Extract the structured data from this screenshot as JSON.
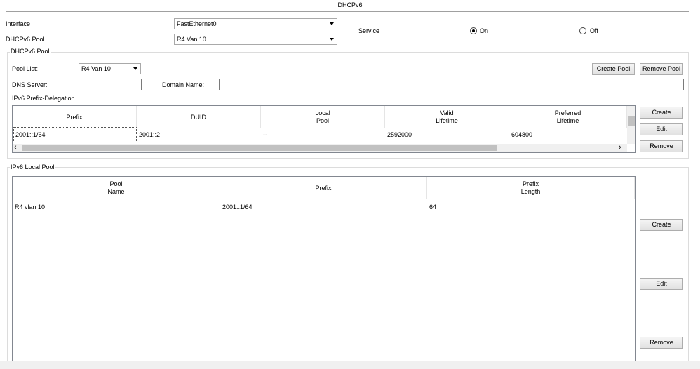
{
  "window": {
    "title": "DHCPv6"
  },
  "top": {
    "interface_label": "Interface",
    "interface_value": "FastEthernet0",
    "pool_label": "DHCPv6 Pool",
    "pool_value": "R4 Van 10",
    "service_label": "Service",
    "service_on": "On",
    "service_off": "Off",
    "service_state": "On"
  },
  "pool_group": {
    "label": "DHCPv6 Pool",
    "pool_list_label": "Pool List:",
    "pool_list_value": "R4 Van 10",
    "create_pool": "Create Pool",
    "remove_pool": "Remove Pool",
    "dns_label": "DNS Server:",
    "dns_value": "",
    "domain_label": "Domain Name:",
    "domain_value": "",
    "prefix_delegation_label": "IPv6 Prefix-Delegation",
    "columns": [
      "Prefix",
      "DUID",
      "Local\nPool",
      "Valid\nLifetime",
      "Preferred\nLifetime"
    ],
    "rows": [
      [
        "2001::1/64",
        "2001::2",
        "--",
        "2592000",
        "604800"
      ]
    ],
    "create": "Create",
    "edit": "Edit",
    "remove": "Remove"
  },
  "local_pool_group": {
    "label": "IPv6 Local Pool",
    "columns": [
      "Pool\nName",
      "Prefix",
      "Prefix\nLength"
    ],
    "rows": [
      [
        "R4 vlan 10",
        "2001::1/64",
        "64"
      ]
    ],
    "create": "Create",
    "edit": "Edit",
    "remove": "Remove"
  },
  "icons": {
    "scroll_left": "‹",
    "scroll_right": "›"
  }
}
